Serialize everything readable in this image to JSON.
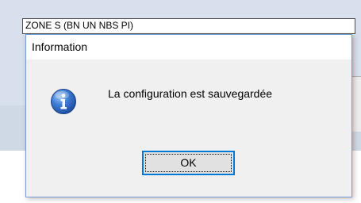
{
  "background_window": {
    "field_value": "ZONE S (BN UN NBS PI)"
  },
  "dialog": {
    "title": "Information",
    "message": "La configuration est sauvegardée",
    "icon": "info-icon",
    "ok_label": "OK"
  },
  "colors": {
    "accent": "#0078d7",
    "dialog_border": "#7a9ad6",
    "dialog_body": "#f0f0f0",
    "icon_blue": "#2a5fb8"
  }
}
